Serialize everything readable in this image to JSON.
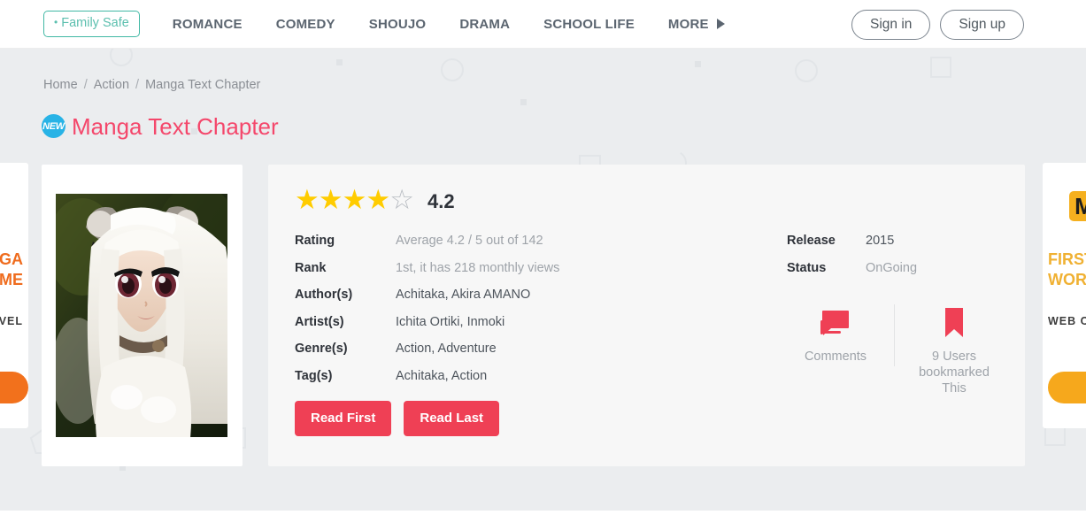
{
  "header": {
    "family_safe_label": "Family Safe",
    "nav_items": [
      {
        "label": "ROMANCE"
      },
      {
        "label": "COMEDY"
      },
      {
        "label": "SHOUJO"
      },
      {
        "label": "DRAMA"
      },
      {
        "label": "SCHOOL LIFE"
      },
      {
        "label": "MORE"
      }
    ],
    "more_icon": "triangle-right-icon",
    "sign_in_label": "Sign in",
    "sign_up_label": "Sign up"
  },
  "breadcrumb": {
    "items": [
      {
        "label": "Home"
      },
      {
        "label": "Action"
      },
      {
        "label": "Manga Text Chapter"
      }
    ],
    "separator": "/"
  },
  "title": {
    "badge": "NEW",
    "text": "Manga Text Chapter",
    "color": "#f4476b"
  },
  "cover": {
    "alt": "manga-cover-image"
  },
  "rating_widget": {
    "stars_filled": 4,
    "stars_total": 5,
    "filled_glyph": "★",
    "empty_glyph": "☆",
    "score": "4.2",
    "star_color": "#ffcc00"
  },
  "details": {
    "left_rows": [
      {
        "label": "Rating",
        "value": "Average 4.2 / 5 out of 142",
        "muted": true
      },
      {
        "label": "Rank",
        "value": "1st, it has 218 monthly views",
        "muted": true
      },
      {
        "label": "Author(s)",
        "value": "Achitaka,  Akira AMANO",
        "muted": false
      },
      {
        "label": "Artist(s)",
        "value": "Ichita Ortiki,  Inmoki",
        "muted": false
      },
      {
        "label": "Genre(s)",
        "value": "Action,   Adventure",
        "muted": false
      },
      {
        "label": "Tag(s)",
        "value": "Achitaka,   Action",
        "muted": false
      }
    ],
    "right_rows": [
      {
        "label": "Release",
        "value": "2015",
        "muted": false
      },
      {
        "label": "Status",
        "value": "OnGoing",
        "muted": true
      }
    ]
  },
  "actions": {
    "comments": {
      "icon": "comments-icon",
      "label": "Comments",
      "color": "#ef4055"
    },
    "bookmark": {
      "icon": "bookmark-icon",
      "label": "9 Users bookmarked This",
      "color": "#ef4055"
    }
  },
  "buttons": {
    "read_first": "Read First",
    "read_last": "Read Last",
    "color": "#ef4055"
  },
  "ads": {
    "left": {
      "title": "MANGA\nGAME",
      "subtitle": "NOVEL",
      "cta": "",
      "color": "#ef6c1e"
    },
    "right": {
      "logo": "M",
      "title": "FIRST\nWORLD",
      "subtitle": "WEB C",
      "cta": "",
      "color": "#f0b133"
    }
  }
}
